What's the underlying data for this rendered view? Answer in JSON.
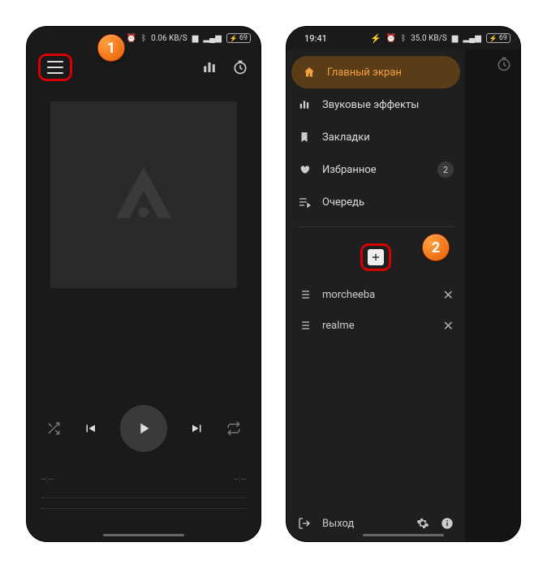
{
  "statusbar": {
    "time": "19:41",
    "net_speed": "0.06",
    "net_unit": "KB/S",
    "net_speed2": "35.0",
    "battery": "69"
  },
  "player": {
    "time_elapsed": "--:--",
    "time_total": "--:--"
  },
  "drawer": {
    "home": "Главный экран",
    "effects": "Звуковые эффекты",
    "bookmarks": "Закладки",
    "favorites": "Избранное",
    "fav_count": "2",
    "queue": "Очередь",
    "exit": "Выход"
  },
  "playlists": [
    {
      "name": "morcheeba"
    },
    {
      "name": "realme"
    }
  ],
  "callouts": {
    "one": "1",
    "two": "2"
  }
}
